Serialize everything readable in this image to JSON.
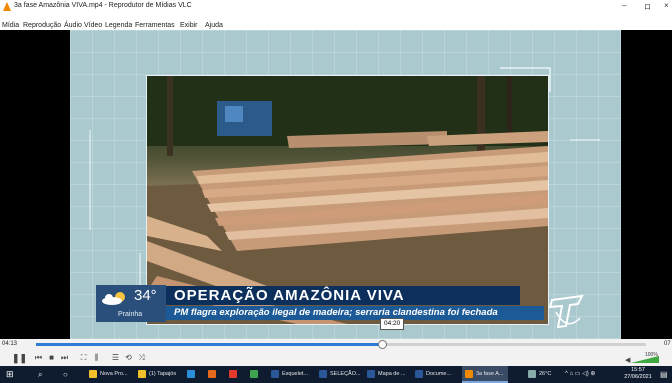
{
  "window": {
    "title": "3a fase Amazônia VIVA.mp4 - Reprodutor de Mídias VLC",
    "minimize": "–",
    "maximize": "ロ",
    "close": "×"
  },
  "menu": [
    "Mídia",
    "Reprodução",
    "Áudio",
    "Vídeo",
    "Legenda",
    "Ferramentas",
    "Exibir",
    "Ajuda"
  ],
  "overlay": {
    "temperature": "34°",
    "city": "Prainha",
    "headline": "OPERAÇÃO AMAZÔNIA VIVA",
    "subheadline": "PM flagra exploração ilegal de madeira; serraria clandestina foi fechada",
    "tooltip_time": "04:20"
  },
  "player": {
    "elapsed": "04:13",
    "total": "07",
    "progress_fraction": 0.568,
    "volume_percent": "100%",
    "colors": {
      "accent": "#2f7cd6",
      "volume": "#3fa83f"
    }
  },
  "controls": [
    {
      "name": "pause-icon",
      "glyph": "❚❚"
    },
    {
      "name": "previous-icon",
      "glyph": "⏮"
    },
    {
      "name": "stop-icon",
      "glyph": "■"
    },
    {
      "name": "next-icon",
      "glyph": "⏭"
    },
    {
      "name": "fullscreen-icon",
      "glyph": "⛶"
    },
    {
      "name": "extended-settings-icon",
      "glyph": "⫼"
    },
    {
      "name": "playlist-icon",
      "glyph": "☰"
    },
    {
      "name": "loop-icon",
      "glyph": "⟲"
    },
    {
      "name": "shuffle-icon",
      "glyph": "⤨"
    }
  ],
  "taskbar": {
    "items": [
      {
        "label": "Nova Pro...",
        "color": "#f2c02a",
        "active": false
      },
      {
        "label": "(1) Tapajós",
        "color": "#f2c02a",
        "active": false
      },
      {
        "label": "",
        "color": "#2b8fd8",
        "active": false
      },
      {
        "label": "",
        "color": "#e66a1e",
        "active": false
      },
      {
        "label": "",
        "color": "#e23b2e",
        "active": false
      },
      {
        "label": "",
        "color": "#3fa34d",
        "active": false
      },
      {
        "label": "Esquelet...",
        "color": "#2b5797",
        "active": false
      },
      {
        "label": "SELEÇÃO...",
        "color": "#2b5797",
        "active": false
      },
      {
        "label": "Mapa de ...",
        "color": "#2b5797",
        "active": false
      },
      {
        "label": "Docume...",
        "color": "#2b5797",
        "active": false
      },
      {
        "label": "3a fase A...",
        "color": "#f08a00",
        "active": true
      }
    ],
    "weather": "26°C",
    "clock_time": "15:57",
    "clock_date": "27/06/2021"
  }
}
